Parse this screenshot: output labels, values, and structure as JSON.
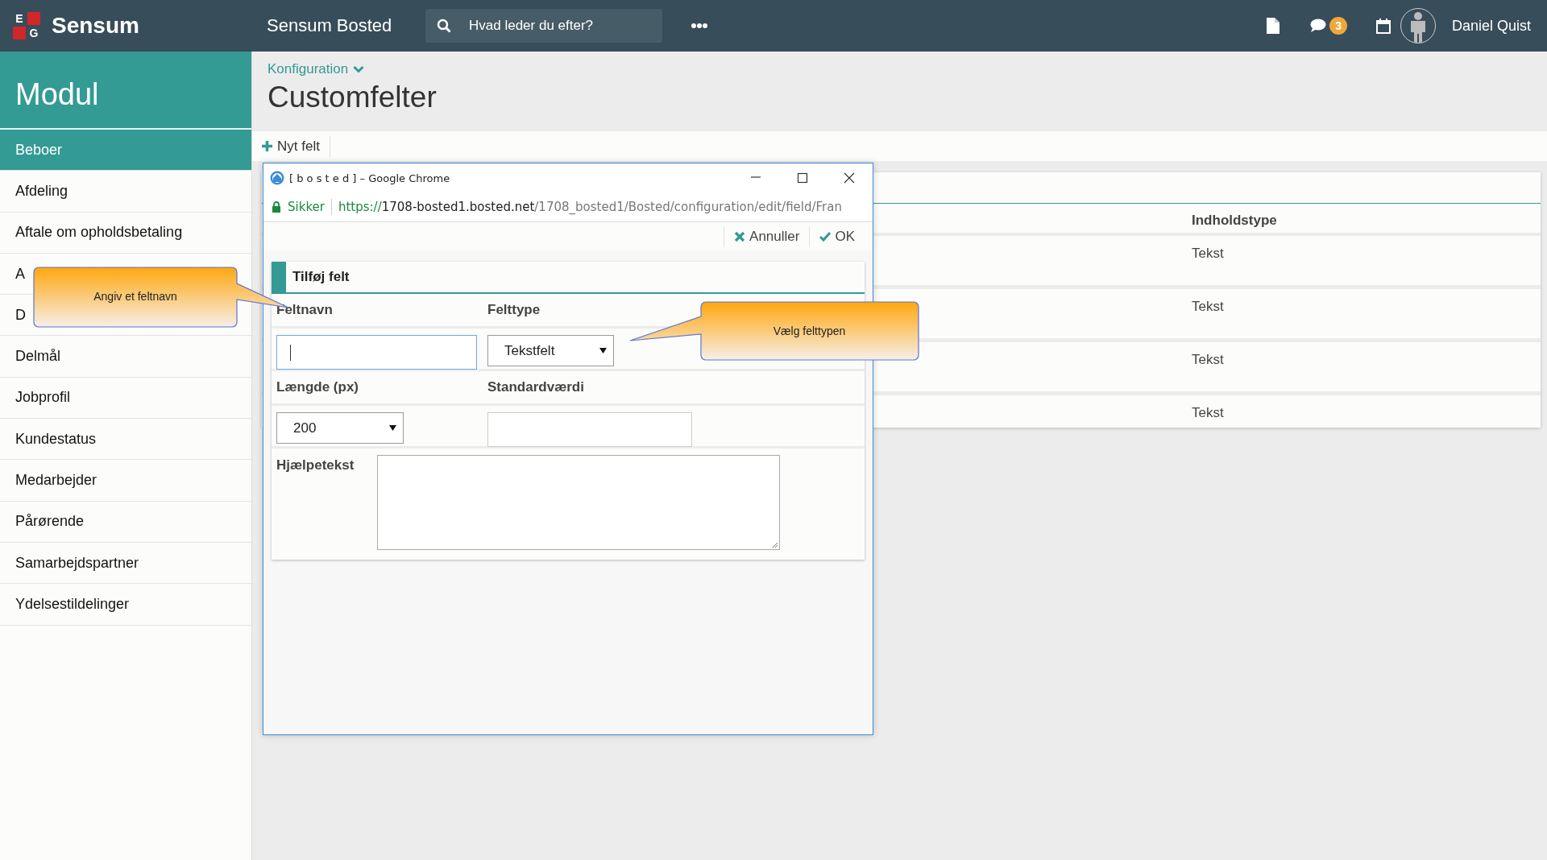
{
  "topbar": {
    "logo_letters": [
      "E",
      "G"
    ],
    "logo_text": "Sensum",
    "app_title": "Sensum Bosted",
    "search": {
      "placeholder": "Hvad leder du efter?"
    },
    "message_count": "3",
    "user_name": "Daniel Quist"
  },
  "sidebar": {
    "title": "Modul",
    "items": [
      {
        "label": "Beboer",
        "selected": true
      },
      {
        "label": "Afdeling",
        "selected": false
      },
      {
        "label": "Aftale om opholdsbetaling",
        "selected": false
      },
      {
        "label": "A",
        "selected": false
      },
      {
        "label": "D",
        "selected": false
      },
      {
        "label": "Delmål",
        "selected": false
      },
      {
        "label": "Jobprofil",
        "selected": false
      },
      {
        "label": "Kundestatus",
        "selected": false
      },
      {
        "label": "Medarbejder",
        "selected": false
      },
      {
        "label": "Pårørende",
        "selected": false
      },
      {
        "label": "Samarbejdspartner",
        "selected": false
      },
      {
        "label": "Ydelsestildelinger",
        "selected": false
      }
    ]
  },
  "breadcrumb": "Konfiguration",
  "page_title": "Customfelter",
  "toolbar": {
    "new_button": "Nyt felt"
  },
  "table": {
    "columns": [
      "Indholdstype"
    ],
    "rows": [
      [
        "Tekst"
      ],
      [
        "Tekst"
      ],
      [
        "Tekst"
      ],
      [
        "Tekst"
      ]
    ]
  },
  "dialog": {
    "window_title": "[ b o s t e d ] – Google Chrome",
    "secure_label": "Sikker",
    "url_scheme": "https://",
    "url_host": "1708-bosted1.bosted.net",
    "url_path": "/1708_bosted1/Bosted/configuration/edit/field/Fran",
    "actions": [
      {
        "kind": "cancel",
        "label": "Annuller"
      },
      {
        "kind": "ok",
        "label": "OK"
      }
    ],
    "form_title": "Tilføj felt",
    "rows": [
      {
        "fields": [
          {
            "label": "Feltnavn",
            "kind": "input",
            "focused": true
          },
          {
            "label": "Felttype",
            "kind": "select",
            "value": "Tekstfelt"
          }
        ]
      },
      {
        "fields": [
          {
            "label": "Længde (px)",
            "kind": "select",
            "value": "200"
          },
          {
            "label": "Standardværdi",
            "kind": "input",
            "focused": false
          }
        ]
      },
      {
        "fields": [
          {
            "label": "Hjælpetekst",
            "kind": "textarea"
          }
        ]
      }
    ]
  },
  "callouts": [
    {
      "text": "Angiv et feltnavn"
    },
    {
      "text": "Vælg felttypen"
    }
  ]
}
